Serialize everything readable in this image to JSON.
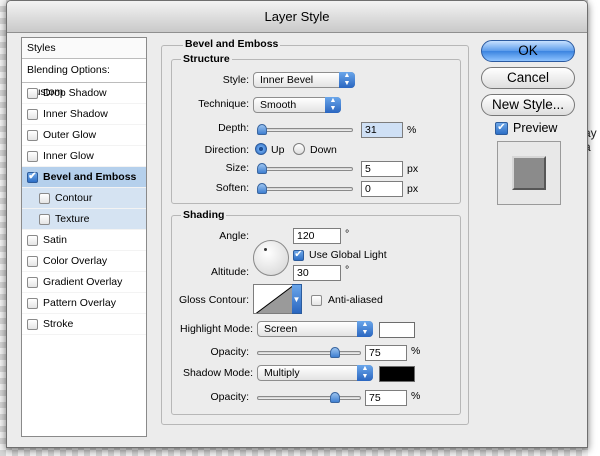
{
  "window": {
    "title": "Layer Style"
  },
  "background": {
    "side_text": "ay a"
  },
  "styles_panel": {
    "header": "Styles",
    "blending": "Blending Options: Custom",
    "items": [
      {
        "label": "Drop Shadow",
        "checked": false
      },
      {
        "label": "Inner Shadow",
        "checked": false
      },
      {
        "label": "Outer Glow",
        "checked": false
      },
      {
        "label": "Inner Glow",
        "checked": false
      },
      {
        "label": "Bevel and Emboss",
        "checked": true
      },
      {
        "label": "Contour",
        "checked": false
      },
      {
        "label": "Texture",
        "checked": false
      },
      {
        "label": "Satin",
        "checked": false
      },
      {
        "label": "Color Overlay",
        "checked": false
      },
      {
        "label": "Gradient Overlay",
        "checked": false
      },
      {
        "label": "Pattern Overlay",
        "checked": false
      },
      {
        "label": "Stroke",
        "checked": false
      }
    ]
  },
  "bevel": {
    "title": "Bevel and Emboss",
    "structure": {
      "title": "Structure",
      "style_label": "Style:",
      "style_value": "Inner Bevel",
      "technique_label": "Technique:",
      "technique_value": "Smooth",
      "depth_label": "Depth:",
      "depth_value": "31",
      "depth_unit": "%",
      "direction_label": "Direction:",
      "dir_up": "Up",
      "dir_down": "Down",
      "size_label": "Size:",
      "size_value": "5",
      "size_unit": "px",
      "soften_label": "Soften:",
      "soften_value": "0",
      "soften_unit": "px"
    },
    "shading": {
      "title": "Shading",
      "angle_label": "Angle:",
      "angle_value": "120",
      "angle_unit": "°",
      "global_light": "Use Global Light",
      "altitude_label": "Altitude:",
      "altitude_value": "30",
      "altitude_unit": "°",
      "gloss_label": "Gloss Contour:",
      "anti_aliased": "Anti-aliased",
      "highlight_label": "Highlight Mode:",
      "highlight_value": "Screen",
      "highlight_color": "#ffffff",
      "opacity_label": "Opacity:",
      "highlight_opacity": "75",
      "opacity_unit": "%",
      "shadow_label": "Shadow Mode:",
      "shadow_value": "Multiply",
      "shadow_color": "#000000",
      "shadow_opacity_label": "Opacity:",
      "shadow_opacity": "75",
      "shadow_opacity_unit": "%"
    }
  },
  "buttons": {
    "ok": "OK",
    "cancel": "Cancel",
    "new_style": "New Style...",
    "preview": "Preview"
  },
  "colors": {
    "accent": "#3b84e0",
    "selection": "#b5d0ec"
  }
}
